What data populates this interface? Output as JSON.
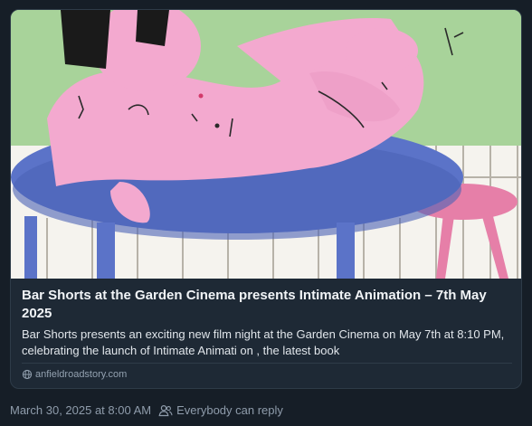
{
  "link_card": {
    "image_alt": "Illustration of a reclining pink figure on a blue table",
    "title": "Bar Shorts at the Garden Cinema presents Intimate Animation – 7th May 2025",
    "description": "Bar Shorts presents an exciting new film night at the Garden Cinema on May 7th at 8:10 PM, celebrating the launch of  Intimate Animati on , the latest book",
    "domain": "anfieldroadstory.com",
    "domain_icon": "globe-icon"
  },
  "post_footer": {
    "timestamp": "March 30, 2025 at 8:00 AM",
    "reply_setting": "Everybody can reply",
    "reply_icon": "people-icon"
  },
  "colors": {
    "background": "#161e27",
    "card_border": "#2e3b48",
    "muted_text": "#8f9cab"
  }
}
